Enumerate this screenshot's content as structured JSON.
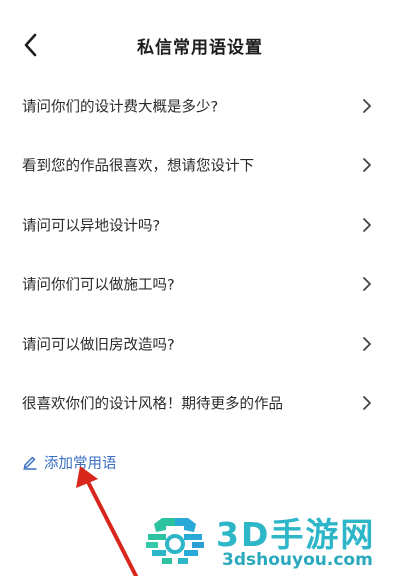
{
  "header": {
    "title": "私信常用语设置",
    "back_icon": "chevron-left-icon"
  },
  "phrases": [
    {
      "label": "请问你们的设计费大概是多少?"
    },
    {
      "label": "看到您的作品很喜欢，想请您设计下"
    },
    {
      "label": "请问可以异地设计吗?"
    },
    {
      "label": "请问你们可以做施工吗?"
    },
    {
      "label": "请问可以做旧房改造吗?"
    },
    {
      "label": "很喜欢你们的设计风格！期待更多的作品"
    }
  ],
  "add_button": {
    "label": "添加常用语",
    "icon": "pencil-icon",
    "color": "#3a6fc4"
  },
  "watermark": {
    "brand": "3D手游网",
    "url": "3dshouyou.com",
    "color": "#2db6c8"
  },
  "annotation": {
    "arrow_color": "#d9261c"
  }
}
